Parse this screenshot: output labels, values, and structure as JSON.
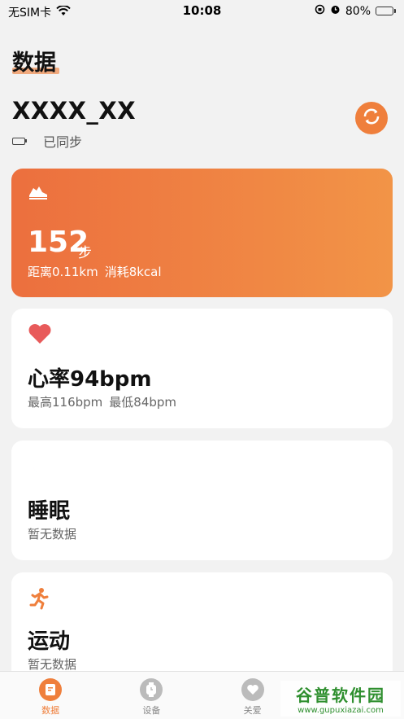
{
  "status_bar": {
    "carrier": "无SIM卡",
    "time": "10:08",
    "battery_percent": "80%"
  },
  "page": {
    "title": "数据"
  },
  "device": {
    "name": "XXXX_XX",
    "sync_status": "已同步"
  },
  "steps": {
    "value": "152",
    "unit": "步",
    "distance": "距离0.11km",
    "calories": "消耗8kcal"
  },
  "heart_rate": {
    "title": "心率94bpm",
    "max": "最高116bpm",
    "min": "最低84bpm"
  },
  "sleep": {
    "title": "睡眠",
    "status": "暂无数据"
  },
  "sport": {
    "title": "运动",
    "status": "暂无数据"
  },
  "tabs": [
    {
      "label": "数据",
      "icon": "data-icon"
    },
    {
      "label": "设备",
      "icon": "watch-icon"
    },
    {
      "label": "关爱",
      "icon": "care-icon"
    }
  ],
  "watermark": {
    "main": "谷普软件园",
    "url": "www.gupuxiazai.com"
  },
  "colors": {
    "accent": "#ef7f3c",
    "steps_gradient_start": "#ec6f3e",
    "steps_gradient_end": "#f29447",
    "heart": "#e85a5a",
    "sleep": "#8b4fe0",
    "sport": "#ef7f3c"
  }
}
